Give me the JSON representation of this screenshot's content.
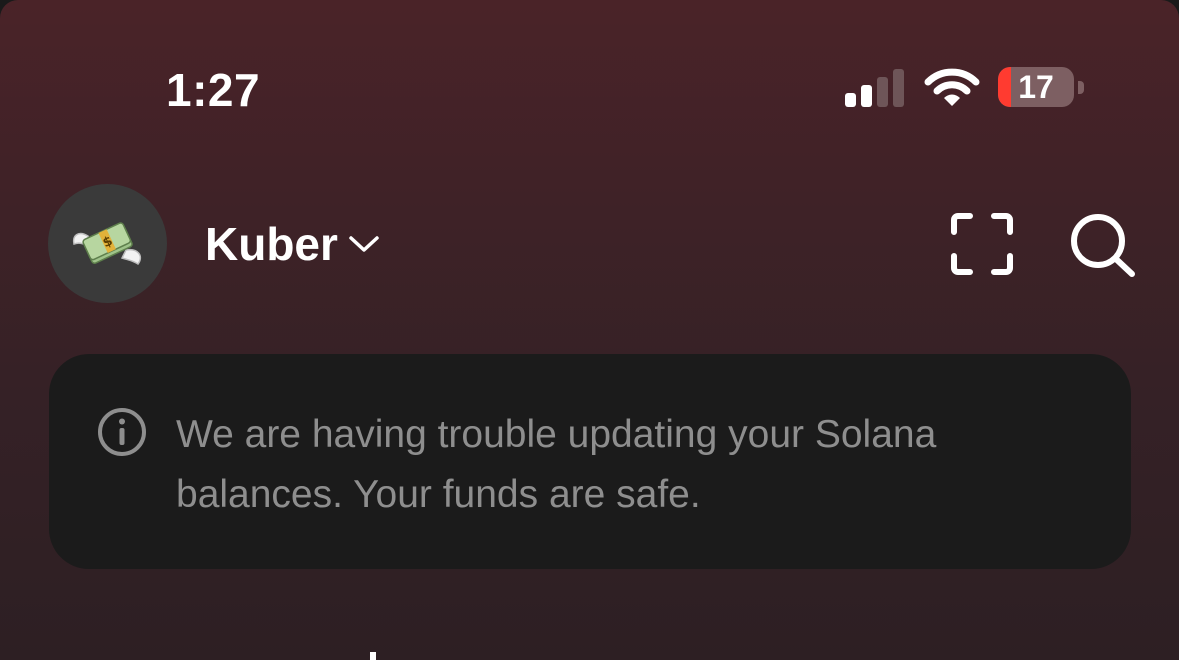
{
  "status_bar": {
    "time": "1:27",
    "signal_icon": "cellular-signal-icon",
    "wifi_icon": "wifi-icon",
    "battery": {
      "level": "17",
      "fraction": 0.17,
      "fill_color": "#ff3b30"
    }
  },
  "header": {
    "avatar_icon": "money-with-wings-emoji",
    "account_name": "Kuber",
    "chevron_icon": "chevron-down-icon",
    "scan_icon": "scan-icon",
    "search_icon": "search-icon"
  },
  "notice": {
    "icon": "info-icon",
    "message": "We are having trouble updating your Solana balances. Your funds are safe."
  },
  "colors": {
    "background_top": "#4a2328",
    "background_bottom": "#2d1f23",
    "card": "#1b1b1b",
    "notice_text": "#8e8e8e",
    "primary_text": "#ffffff"
  }
}
